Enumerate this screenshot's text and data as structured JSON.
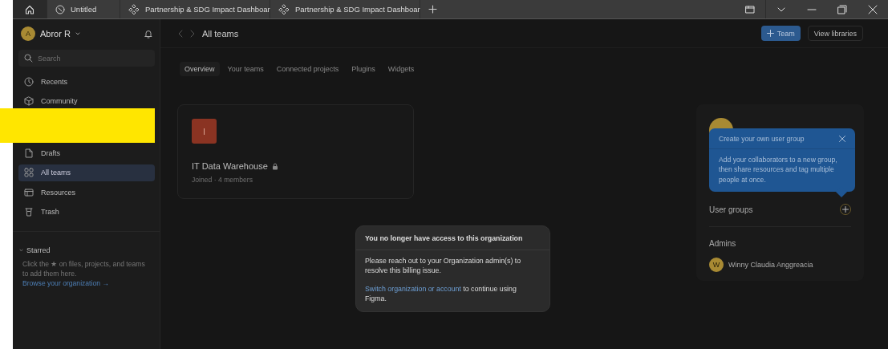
{
  "tabs": [
    {
      "kind": "home",
      "selected": true
    },
    {
      "kind": "file",
      "title": "Untitled",
      "selected": false
    },
    {
      "kind": "design",
      "title": "Partnership & SDG Impact Dashboar",
      "selected": false
    },
    {
      "kind": "design",
      "title": "Partnership & SDG Impact Dashboar",
      "selected": false
    }
  ],
  "sidebar": {
    "user": {
      "initial": "A",
      "name": "Abror R"
    },
    "search": {
      "placeholder": "Search"
    },
    "items": [
      {
        "kind": "clock",
        "label": "Recents",
        "selected": false
      },
      {
        "kind": "cube",
        "label": "Community",
        "selected": false
      },
      {
        "kind": "gap"
      },
      {
        "kind": "file",
        "label": "Drafts",
        "selected": false
      },
      {
        "kind": "grid",
        "label": "All teams",
        "selected": true
      },
      {
        "kind": "layout",
        "label": "Resources",
        "selected": false
      },
      {
        "kind": "trash",
        "label": "Trash",
        "selected": false
      }
    ],
    "starred": {
      "title": "Starred",
      "hint": "Click the ★ on files, projects, and teams to add them here.",
      "link": "Browse your organization →"
    }
  },
  "header": {
    "title": "All teams",
    "buttons": [
      {
        "kind": "primary",
        "label": "Team"
      },
      {
        "kind": "secondary",
        "label": "View libraries"
      }
    ]
  },
  "content_tabs": [
    {
      "label": "Overview",
      "selected": true
    },
    {
      "label": "Your teams",
      "selected": false
    },
    {
      "label": "Connected projects",
      "selected": false
    },
    {
      "label": "Plugins",
      "selected": false
    },
    {
      "label": "Widgets",
      "selected": false
    }
  ],
  "team_card": {
    "initial": "I",
    "name": "IT Data Warehouse",
    "locked": true,
    "meta": "Joined · 4 members"
  },
  "org_panel": {
    "user_groups": "User groups",
    "admins_title": "Admins",
    "admins": [
      {
        "initial": "W",
        "name": "Winny Claudia Anggreacia"
      }
    ]
  },
  "tooltip": {
    "title": "Create your own user group",
    "body": "Add your collaborators to a new group, then share resources and tag multiple people at once."
  },
  "dialog": {
    "title": "You no longer have access to this organization",
    "body": "Please reach out to your Organization admin(s) to resolve this billing issue.",
    "link": "Switch organization or account",
    "after": " to continue using Figma."
  }
}
